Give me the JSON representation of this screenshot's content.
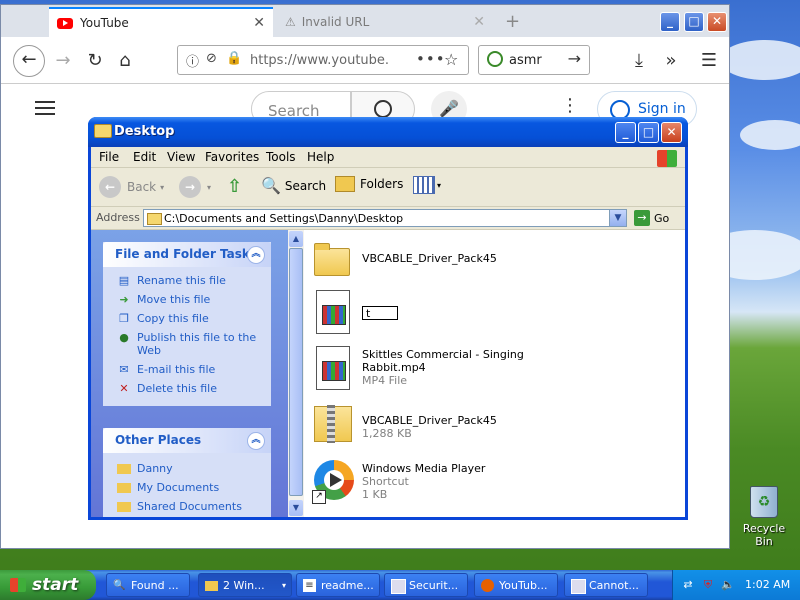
{
  "browser": {
    "tabs": [
      {
        "title": "YouTube",
        "icon": "youtube-icon",
        "active": true
      },
      {
        "title": "Invalid URL",
        "icon": "warning-icon",
        "active": false
      }
    ],
    "newtab": "+",
    "url": "https://www.youtube.",
    "search_value": "asmr"
  },
  "youtube": {
    "search_placeholder": "Search",
    "signin_label": "Sign in"
  },
  "explorer": {
    "title": "Desktop",
    "menu": [
      "File",
      "Edit",
      "View",
      "Favorites",
      "Tools",
      "Help"
    ],
    "toolbar": {
      "back": "Back",
      "search": "Search",
      "folders": "Folders"
    },
    "address_label": "Address",
    "address": "C:\\Documents and Settings\\Danny\\Desktop",
    "go_label": "Go",
    "file_tasks": {
      "title": "File and Folder Tasks",
      "items": [
        {
          "label": "Rename this file",
          "icon": "rename-icon"
        },
        {
          "label": "Move this file",
          "icon": "move-icon"
        },
        {
          "label": "Copy this file",
          "icon": "copy-icon"
        },
        {
          "label": "Publish this file to the Web",
          "icon": "globe-icon"
        },
        {
          "label": "E-mail this file",
          "icon": "email-icon"
        },
        {
          "label": "Delete this file",
          "icon": "delete-icon"
        }
      ]
    },
    "other_places": {
      "title": "Other Places",
      "items": [
        {
          "label": "Danny",
          "icon": "folder-icon"
        },
        {
          "label": "My Documents",
          "icon": "folder-icon"
        },
        {
          "label": "Shared Documents",
          "icon": "folder-icon"
        }
      ]
    },
    "files": [
      {
        "name": "VBCABLE_Driver_Pack45",
        "meta1": "",
        "meta2": ""
      },
      {
        "name": "t",
        "meta1": "",
        "meta2": ""
      },
      {
        "name": "Skittles Commercial - Singing Rabbit.mp4",
        "meta1": "MP4 File",
        "meta2": ""
      },
      {
        "name": "VBCABLE_Driver_Pack45",
        "meta1": "1,288 KB",
        "meta2": ""
      },
      {
        "name": "Windows Media Player",
        "meta1": "Shortcut",
        "meta2": "1 KB"
      }
    ]
  },
  "desktop": {
    "recycle_bin": "Recycle Bin"
  },
  "taskbar": {
    "start": "start",
    "buttons": [
      {
        "label": "Found ...",
        "icon": "search-icon"
      },
      {
        "label": "2 Win...",
        "icon": "folder-icon",
        "active": true
      },
      {
        "label": "readme...",
        "icon": "notepad-icon"
      },
      {
        "label": "Securit...",
        "icon": "window-icon"
      },
      {
        "label": "YouTub...",
        "icon": "firefox-icon"
      },
      {
        "label": "Cannot...",
        "icon": "window-icon"
      }
    ],
    "clock": "1:02 AM"
  }
}
